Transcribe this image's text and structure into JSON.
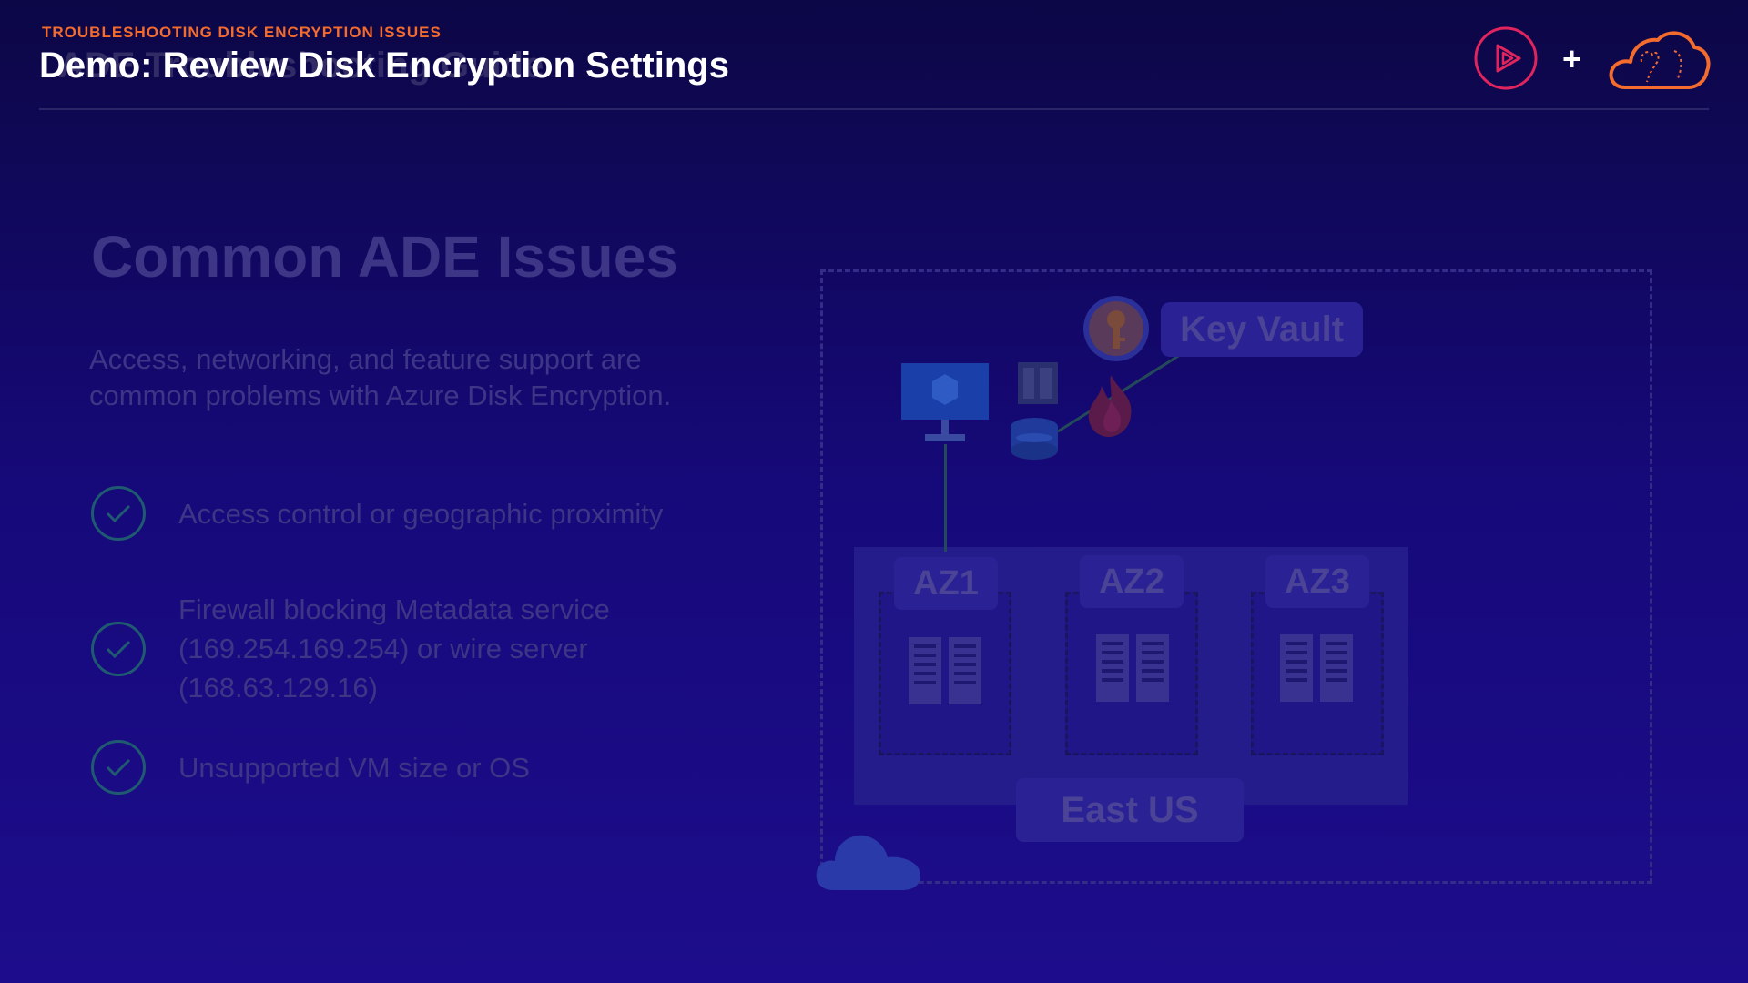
{
  "header": {
    "kicker": "TROUBLESHOOTING DISK ENCRYPTION ISSUES",
    "title": "Demo: Review Disk Encryption Settings",
    "ghost_title": "ADE Troubleshooting Guide",
    "logo_plus": "+",
    "icons": [
      "pluralsight-play-icon",
      "cloud-guru-cloud-icon"
    ]
  },
  "slide": {
    "heading": "Common ADE Issues",
    "subtitle": "Access, networking, and feature support are common problems with Azure Disk Encryption.",
    "items": [
      {
        "text": "Access control or geographic proximity"
      },
      {
        "text": "Firewall blocking Metadata service (169.254.169.254) or wire server (168.63.129.16)"
      },
      {
        "text": "Unsupported VM size or OS"
      }
    ]
  },
  "diagram": {
    "key_vault_label": "Key Vault",
    "region_label": "East US",
    "zones": [
      "AZ1",
      "AZ2",
      "AZ3"
    ]
  },
  "colors": {
    "accent_orange": "#f46b2e",
    "logo_red": "#e0245e",
    "background_top": "#0c0746",
    "background_bottom": "#1d0d8c"
  }
}
